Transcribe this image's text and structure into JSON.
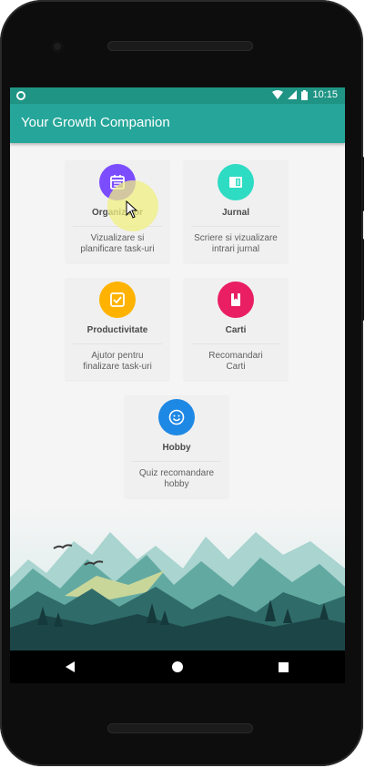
{
  "status_bar": {
    "time": "10:15"
  },
  "app_bar": {
    "title": "Your Growth Companion"
  },
  "cards": [
    {
      "title": "Organizator",
      "description": "Vizualizare si\nplanificare task-uri",
      "icon": "calendar-icon",
      "color": "#7c4dff"
    },
    {
      "title": "Jurnal",
      "description": "Scriere si vizualizare\nintrari jurnal",
      "icon": "journal-icon",
      "color": "#1de9b6"
    },
    {
      "title": "Productivitate",
      "description": "Ajutor pentru\nfinalizare task-uri",
      "icon": "check-square-icon",
      "color": "#ffb300"
    },
    {
      "title": "Carti",
      "description": "Recomandari\nCarti",
      "icon": "bookmark-book-icon",
      "color": "#e91e63"
    },
    {
      "title": "Hobby",
      "description": "Quiz recomandare\nhobby",
      "icon": "smiley-icon",
      "color": "#1e88e5"
    }
  ],
  "colors": {
    "status_bar": "#1f9484",
    "app_bar": "#26a69a",
    "background": "#f5f5f5"
  }
}
